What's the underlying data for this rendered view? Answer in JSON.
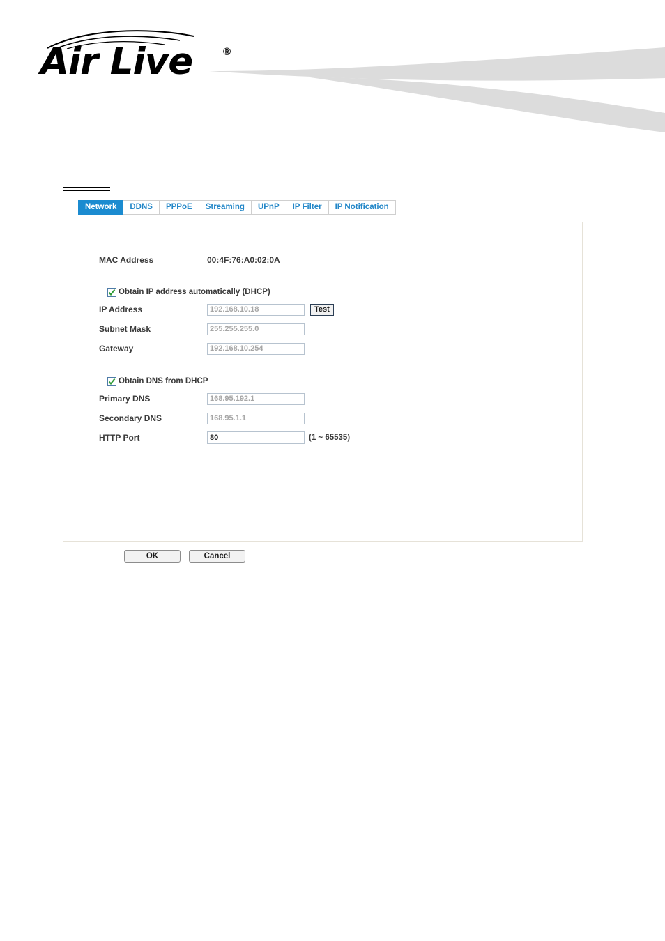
{
  "brand": {
    "name": "Air Live",
    "registered_mark": "®"
  },
  "tabs": [
    {
      "label": "Network",
      "active": true
    },
    {
      "label": "DDNS",
      "active": false
    },
    {
      "label": "PPPoE",
      "active": false
    },
    {
      "label": "Streaming",
      "active": false
    },
    {
      "label": "UPnP",
      "active": false
    },
    {
      "label": "IP Filter",
      "active": false
    },
    {
      "label": "IP Notification",
      "active": false
    }
  ],
  "form": {
    "mac_label": "MAC Address",
    "mac_value": "00:4F:76:A0:02:0A",
    "dhcp_checkbox_label": "Obtain IP address automatically (DHCP)",
    "ip_label": "IP Address",
    "ip_value": "192.168.10.18",
    "test_button": "Test",
    "subnet_label": "Subnet Mask",
    "subnet_value": "255.255.255.0",
    "gateway_label": "Gateway",
    "gateway_value": "192.168.10.254",
    "dns_checkbox_label": "Obtain DNS from DHCP",
    "primary_dns_label": "Primary DNS",
    "primary_dns_value": "168.95.192.1",
    "secondary_dns_label": "Secondary DNS",
    "secondary_dns_value": "168.95.1.1",
    "http_port_label": "HTTP Port",
    "http_port_value": "80",
    "http_port_hint": "(1 ~ 65535)"
  },
  "footer": {
    "ok_label": "OK",
    "cancel_label": "Cancel"
  },
  "colors": {
    "tab_active_bg": "#1b8bd0",
    "tab_text": "#2387c8",
    "swoosh": "#dcdcdc",
    "panel_border": "#e6e2d8"
  }
}
